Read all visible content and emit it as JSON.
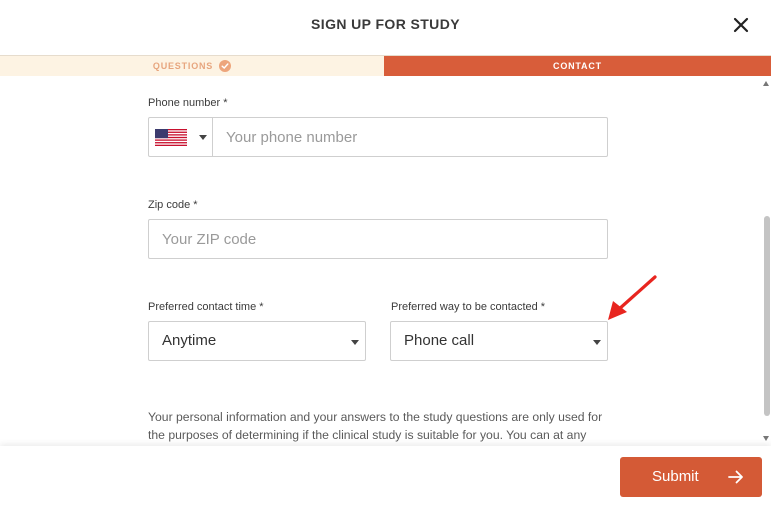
{
  "header": {
    "title": "SIGN UP FOR STUDY",
    "close_icon": "close-icon"
  },
  "steps": {
    "questions_label": "QUESTIONS",
    "contact_label": "CONTACT",
    "active": "CONTACT",
    "colors": {
      "active_bg": "#d85d3a",
      "done_bg": "#fdf3e3",
      "done_text": "#e7a57e"
    }
  },
  "form": {
    "phone": {
      "label": "Phone number *",
      "placeholder": "Your phone number",
      "value": "",
      "country_flag_icon": "us-flag-icon"
    },
    "zip": {
      "label": "Zip code *",
      "placeholder": "Your ZIP code",
      "value": ""
    },
    "contact_time": {
      "label": "Preferred contact time *",
      "selected": "Anytime"
    },
    "contact_method": {
      "label": "Preferred way to be contacted *",
      "selected": "Phone call"
    },
    "disclaimer": "Your personal information and your answers to the study questions are only used for the purposes of determining if the clinical study is suitable for you. You can at any"
  },
  "footer": {
    "submit_label": "Submit",
    "submit_icon": "arrow-right-icon",
    "accent_color": "#d45a36"
  },
  "annotation": {
    "arrow_icon": "red-arrow-annotation",
    "color": "#e8251f"
  }
}
